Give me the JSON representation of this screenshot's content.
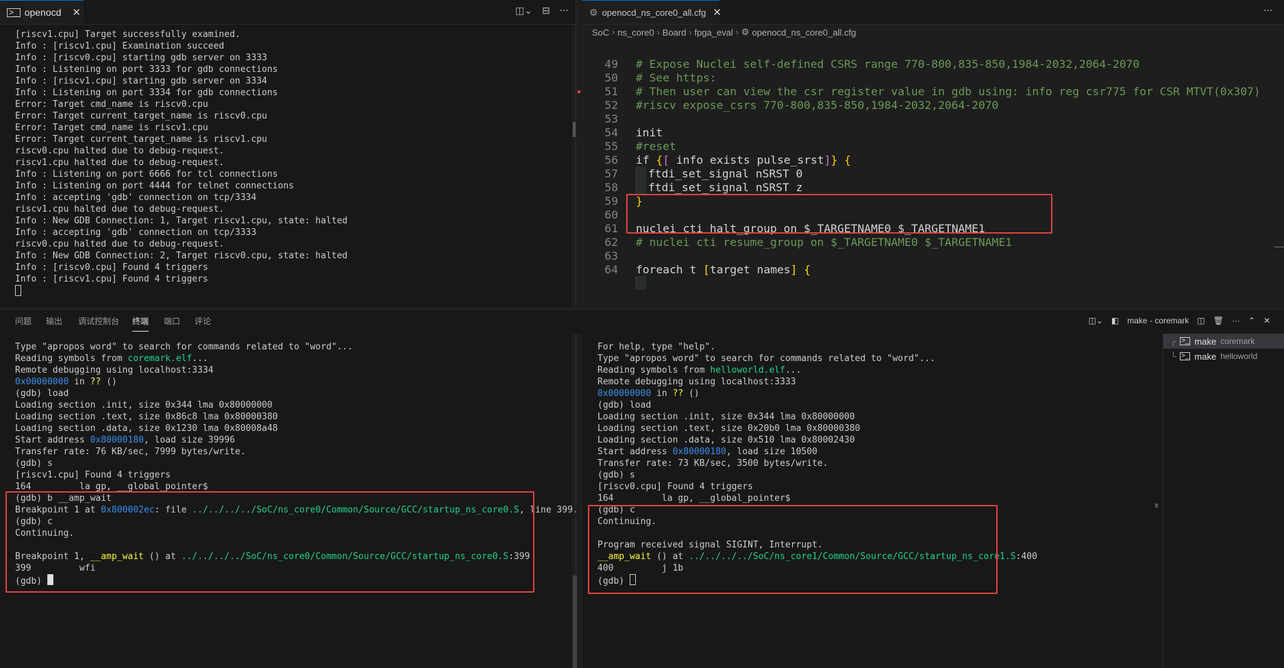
{
  "left_tab": {
    "title": "openocd"
  },
  "right_tab": {
    "title": "openocd_ns_core0_all.cfg"
  },
  "breadcrumb": [
    "SoC",
    "ns_core0",
    "Board",
    "fpga_eval",
    "openocd_ns_core0_all.cfg"
  ],
  "openocd_output": [
    "[riscv1.cpu] Target successfully examined.",
    "Info : [riscv1.cpu] Examination succeed",
    "Info : [riscv0.cpu] starting gdb server on 3333",
    "Info : Listening on port 3333 for gdb connections",
    "Info : [riscv1.cpu] starting gdb server on 3334",
    "Info : Listening on port 3334 for gdb connections",
    "Error: Target cmd_name is riscv0.cpu",
    "Error: Target current_target_name is riscv0.cpu",
    "Error: Target cmd_name is riscv1.cpu",
    "Error: Target current_target_name is riscv1.cpu",
    "riscv0.cpu halted due to debug-request.",
    "riscv1.cpu halted due to debug-request.",
    "Info : Listening on port 6666 for tcl connections",
    "Info : Listening on port 4444 for telnet connections",
    "Info : accepting 'gdb' connection on tcp/3334",
    "riscv1.cpu halted due to debug-request.",
    "Info : New GDB Connection: 1, Target riscv1.cpu, state: halted",
    "Info : accepting 'gdb' connection on tcp/3333",
    "riscv0.cpu halted due to debug-request.",
    "Info : New GDB Connection: 2, Target riscv0.cpu, state: halted",
    "Info : [riscv0.cpu] Found 4 triggers",
    "Info : [riscv1.cpu] Found 4 triggers"
  ],
  "code_lines": [
    {
      "n": "49",
      "t": "# Expose Nuclei self-defined CSRS range 770-800,835-850,1984-2032,2064-2070"
    },
    {
      "n": "50",
      "t": "# See https:"
    },
    {
      "n": "51",
      "t": "# Then user can view the csr register value in gdb using: info reg csr775 for CSR MTVT(0x307)"
    },
    {
      "n": "52",
      "t": "#riscv expose_csrs 770-800,835-850,1984-2032,2064-2070"
    },
    {
      "n": "53",
      "t": ""
    },
    {
      "n": "54",
      "t": "init"
    },
    {
      "n": "55",
      "t": "#reset"
    },
    {
      "n": "56",
      "t": "if {[ info exists pulse_srst]} {"
    },
    {
      "n": "57",
      "t": "ftdi_set_signal nSRST 0"
    },
    {
      "n": "58",
      "t": "ftdi_set_signal nSRST z"
    },
    {
      "n": "59",
      "t": "}"
    },
    {
      "n": "60",
      "t": ""
    },
    {
      "n": "61",
      "t": "nuclei cti halt_group on $_TARGETNAME0 $_TARGETNAME1"
    },
    {
      "n": "62",
      "t": "# nuclei cti resume_group on $_TARGETNAME0 $_TARGETNAME1"
    },
    {
      "n": "63",
      "t": ""
    },
    {
      "n": "64",
      "t": "foreach t [target names] {"
    }
  ],
  "panel_tabs": [
    "问题",
    "输出",
    "调试控制台",
    "终端",
    "端口",
    "评论"
  ],
  "panel_active_tab": "终端",
  "terminal_header": "make - coremark",
  "terminal_list": [
    {
      "name": "make",
      "sub": "coremark"
    },
    {
      "name": "make",
      "sub": "helloworld"
    }
  ],
  "gdb_left": {
    "l1a": "Type \"apropos word\" to search for commands related to \"word\"...",
    "l2a": "Reading symbols from ",
    "l2b": "coremark.elf",
    "l2c": "...",
    "l3": "Remote debugging using localhost:3334",
    "l4a": "0x00000000",
    "l4b": " in ",
    "l4c": "??",
    "l4d": " ()",
    "l5": "(gdb) load",
    "l6": "Loading section .init, size 0x344 lma 0x80000000",
    "l7": "Loading section .text, size 0x86c8 lma 0x80000380",
    "l8": "Loading section .data, size 0x1230 lma 0x80008a48",
    "l9a": "Start address ",
    "l9b": "0x80000180",
    "l9c": ", load size 39996",
    "l10": "Transfer rate: 76 KB/sec, 7999 bytes/write.",
    "l11": "(gdb) s",
    "l12": "[riscv1.cpu] Found 4 triggers",
    "l13": "164         la gp, __global_pointer$",
    "l14": "(gdb) b __amp_wait",
    "l15a": "Breakpoint 1 at ",
    "l15b": "0x800002ec",
    "l15c": ": file ",
    "l15d": "../../../../SoC/ns_core0/Common/Source/GCC/startup_ns_core0.S",
    "l15e": ", line 399.",
    "l16": "(gdb) c",
    "l17": "Continuing.",
    "l18": "",
    "l19a": "Breakpoint 1, ",
    "l19b": "__amp_wait",
    "l19c": " () at ",
    "l19d": "../../../../SoC/ns_core0/Common/Source/GCC/startup_ns_core0.S",
    "l19e": ":399",
    "l20": "399         wfi",
    "l21": "(gdb) "
  },
  "gdb_right": {
    "l1": "For help, type \"help\".",
    "l2": "Type \"apropos word\" to search for commands related to \"word\"...",
    "l3a": "Reading symbols from ",
    "l3b": "helloworld.elf",
    "l3c": "...",
    "l4": "Remote debugging using localhost:3333",
    "l5a": "0x00000000",
    "l5b": " in ",
    "l5c": "??",
    "l5d": " ()",
    "l6": "(gdb) load",
    "l7": "Loading section .init, size 0x344 lma 0x80000000",
    "l8": "Loading section .text, size 0x20b0 lma 0x80000380",
    "l9": "Loading section .data, size 0x510 lma 0x80002430",
    "l10a": "Start address ",
    "l10b": "0x80000180",
    "l10c": ", load size 10500",
    "l11": "Transfer rate: 73 KB/sec, 3500 bytes/write.",
    "l12": "(gdb) s",
    "l13": "[riscv0.cpu] Found 4 triggers",
    "l14": "164         la gp, __global_pointer$",
    "l15": "(gdb) c",
    "l16": "Continuing.",
    "l17": "",
    "l18": "Program received signal SIGINT, Interrupt.",
    "l19a": "__amp_wait",
    "l19b": " () at ",
    "l19c": "../../../../SoC/ns_core1/Common/Source/GCC/startup_ns_core1.S",
    "l19d": ":400",
    "l20": "400         j 1b",
    "l21": "(gdb) "
  },
  "colors": {
    "highlight_box": "#e0443e",
    "accent": "#0078d4",
    "link_blue": "#3b8eea",
    "path_green": "#23d18b",
    "comment": "#6a9955"
  }
}
